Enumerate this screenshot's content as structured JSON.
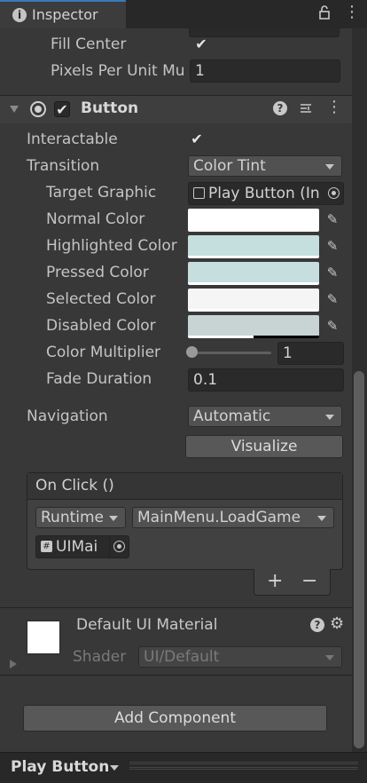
{
  "window": {
    "tab_title": "Inspector",
    "tab_icon": "info-icon",
    "lock_icon": "lock-icon",
    "menu_icon": "kebab-menu-icon"
  },
  "image_section": {
    "fill_center_label": "Fill Center",
    "fill_center_checked": true,
    "ppu_label": "Pixels Per Unit Mu",
    "ppu_value": "1"
  },
  "button_component": {
    "title": "Button",
    "enabled": true,
    "help_icon": "help-icon",
    "presets_icon": "presets-icon",
    "menu_icon": "kebab-menu-icon",
    "interactable_label": "Interactable",
    "interactable_checked": true,
    "transition_label": "Transition",
    "transition_value": "Color Tint",
    "target_graphic_label": "Target Graphic",
    "target_graphic_value": "Play Button (In",
    "normal_color_label": "Normal Color",
    "highlighted_color_label": "Highlighted Color",
    "pressed_color_label": "Pressed Color",
    "selected_color_label": "Selected Color",
    "disabled_color_label": "Disabled Color",
    "color_multiplier_label": "Color Multiplier",
    "color_multiplier_value": "1",
    "color_multiplier_slider": 0,
    "fade_duration_label": "Fade Duration",
    "fade_duration_value": "0.1",
    "navigation_label": "Navigation",
    "navigation_value": "Automatic",
    "visualize_label": "Visualize",
    "colors": {
      "normal": "#ffffff",
      "highlighted": "#c5dede",
      "pressed": "#c6dede",
      "selected": "#f5f5f5",
      "disabled": "#c8d4d4"
    },
    "alpha": {
      "normal": 1.0,
      "highlighted": 1.0,
      "pressed": 1.0,
      "selected": 1.0,
      "disabled": 0.5
    }
  },
  "on_click": {
    "header": "On Click ()",
    "runtime_value": "Runtime",
    "function_value": "MainMenu.LoadGame",
    "object_value": "UIMai",
    "add_label": "+",
    "remove_label": "−"
  },
  "material": {
    "title": "Default UI Material",
    "shader_label": "Shader",
    "shader_value": "UI/Default"
  },
  "add_component_label": "Add Component",
  "bottom": {
    "object_name": "Play Button"
  }
}
